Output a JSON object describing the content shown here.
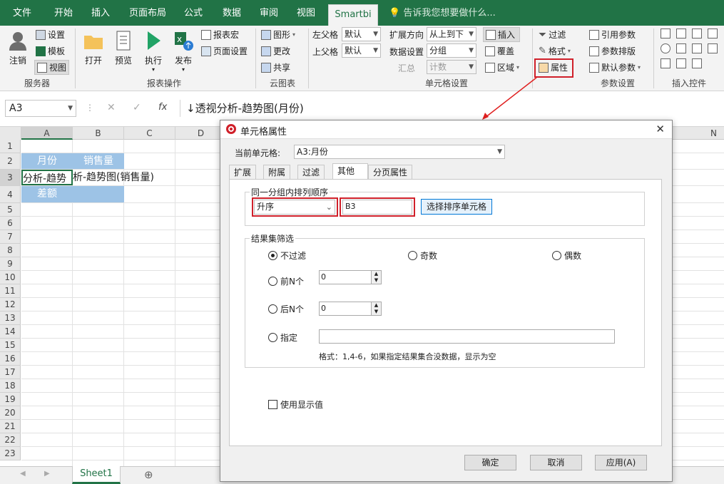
{
  "tabs": [
    "文件",
    "开始",
    "插入",
    "页面布局",
    "公式",
    "数据",
    "审阅",
    "视图",
    "Smartbi"
  ],
  "tell_me": "告诉我您想要做什么...",
  "ribbon": {
    "server": {
      "settings": "设置",
      "template": "模板",
      "view": "视图",
      "logout": "注销",
      "group": "服务器"
    },
    "report_ops": {
      "open": "打开",
      "preview": "预览",
      "execute": "执行",
      "publish": "发布",
      "macro": "报表宏",
      "page_setup": "页面设置",
      "group": "报表操作"
    },
    "cloud": {
      "graph": "图形",
      "change": "更改",
      "share": "共享",
      "group": "云图表"
    },
    "cell_settings": {
      "left_parent": "左父格",
      "left_parent_val": "默认",
      "top_parent": "上父格",
      "top_parent_val": "默认",
      "expand_dir": "扩展方向",
      "expand_dir_val": "从上到下",
      "data_setting": "数据设置",
      "data_setting_val": "分组",
      "summary": "汇总",
      "summary_val": "计数",
      "insert": "插入",
      "cover": "覆盖",
      "area": "区域",
      "group": "单元格设置"
    },
    "param": {
      "filter": "过滤",
      "format": "格式",
      "property": "属性",
      "ref_param": "引用参数",
      "param_layout": "参数排版",
      "default_param": "默认参数",
      "group": "参数设置"
    },
    "insert_ctrl": {
      "group": "插入控件"
    }
  },
  "formula_bar": {
    "name_box": "A3",
    "cancel": "✕",
    "confirm": "✓",
    "fx": "fx",
    "content": "↓透视分析-趋势图(月份)"
  },
  "columns": [
    "A",
    "B",
    "C",
    "D",
    "N"
  ],
  "rows": [
    "1",
    "2",
    "3",
    "4",
    "5",
    "6",
    "7",
    "8",
    "9",
    "10",
    "11",
    "12",
    "13",
    "14",
    "15",
    "16",
    "17",
    "18",
    "19",
    "20",
    "21",
    "22",
    "23"
  ],
  "cells": {
    "a2": "月份",
    "b2": "销售量",
    "a3": "分析-趋势",
    "b3": "析-趋势图(销售量)",
    "a4": "差额"
  },
  "sheet_tab": "Sheet1",
  "dialog": {
    "title": "单元格属性",
    "current_cell_label": "当前单元格:",
    "current_cell_value": "A3:月份",
    "tabs": [
      "扩展",
      "附属",
      "过滤",
      "其他",
      "分页属性"
    ],
    "sort_group_title": "同一分组内排列顺序",
    "sort_order": "升序",
    "sort_cell": "B3",
    "choose_sort_cell": "选择排序单元格",
    "filter_group_title": "结果集筛选",
    "no_filter": "不过滤",
    "odd": "奇数",
    "even": "偶数",
    "top_n": "前N个",
    "top_n_val": "0",
    "bottom_n": "后N个",
    "bottom_n_val": "0",
    "specify": "指定",
    "format_hint": "格式：1,4-6，如果指定结果集合没数据，显示为空",
    "use_display_value": "使用显示值",
    "ok": "确定",
    "cancel": "取消",
    "apply": "应用(A)"
  }
}
